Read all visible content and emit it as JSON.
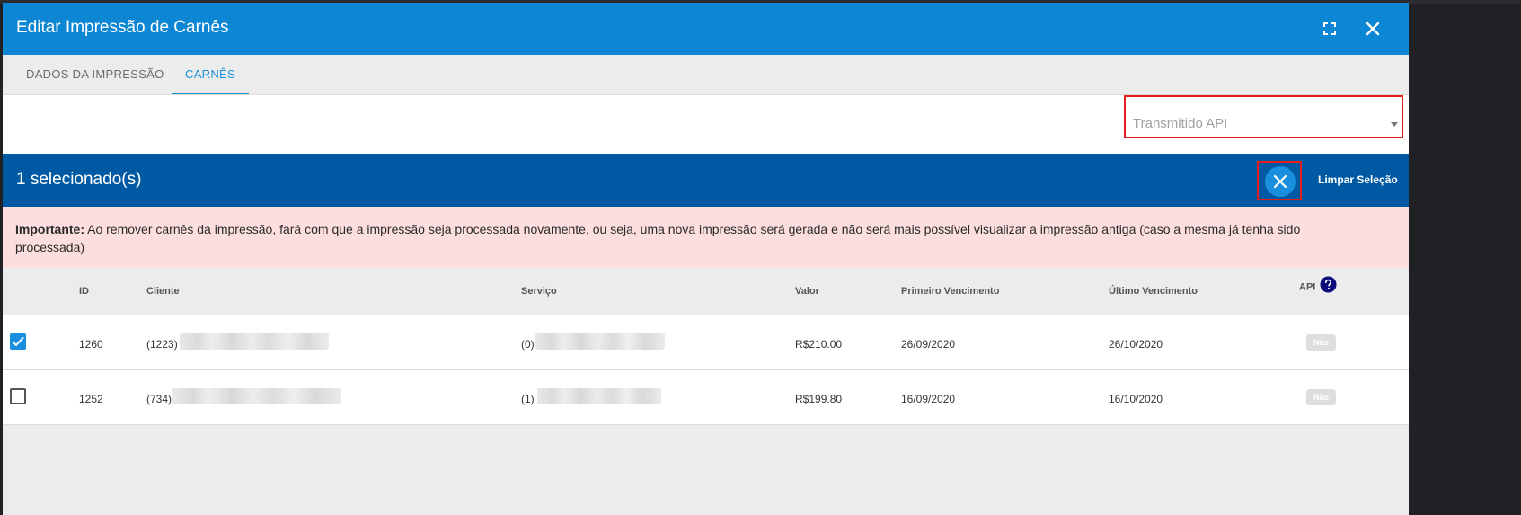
{
  "window": {
    "title": "Editar Impressão de Carnês"
  },
  "header_icons": {
    "fullscreen": "fullscreen-icon",
    "close": "close-icon"
  },
  "tabs": [
    {
      "label": "DADOS DA IMPRESSÃO",
      "active": false
    },
    {
      "label": "CARNÊS",
      "active": true
    }
  ],
  "filter": {
    "placeholder": "Transmitido API"
  },
  "selection": {
    "count_text": "1 selecionado(s)",
    "clear_label": "Limpar Seleção"
  },
  "warning": {
    "strong": "Importante:",
    "text": " Ao remover carnês da impressão, fará com que a impressão seja processada novamente, ou seja, uma nova impressão será gerada e não será mais possível visualizar a impressão antiga (caso a mesma já tenha sido processada)"
  },
  "table": {
    "headers": {
      "id": "ID",
      "cliente": "Cliente",
      "servico": "Serviço",
      "valor": "Valor",
      "primeiro": "Primeiro Vencimento",
      "ultimo": "Último Vencimento",
      "api": "API"
    },
    "rows": [
      {
        "checked": true,
        "id": "1260",
        "cliente": "(1223)",
        "servico": "(0)",
        "valor": "R$210.00",
        "primeiro": "26/09/2020",
        "ultimo": "26/10/2020",
        "api": "Não"
      },
      {
        "checked": false,
        "id": "1252",
        "cliente": "(734)",
        "servico": "(1)",
        "valor": "R$199.80",
        "primeiro": "16/09/2020",
        "ultimo": "16/10/2020",
        "api": "Não"
      }
    ]
  },
  "colors": {
    "header": "#0d87d3",
    "selection_bar": "#0059a3",
    "accent": "#1a8fe0",
    "warning_bg": "#fddede",
    "highlight": "#e41e1e"
  }
}
